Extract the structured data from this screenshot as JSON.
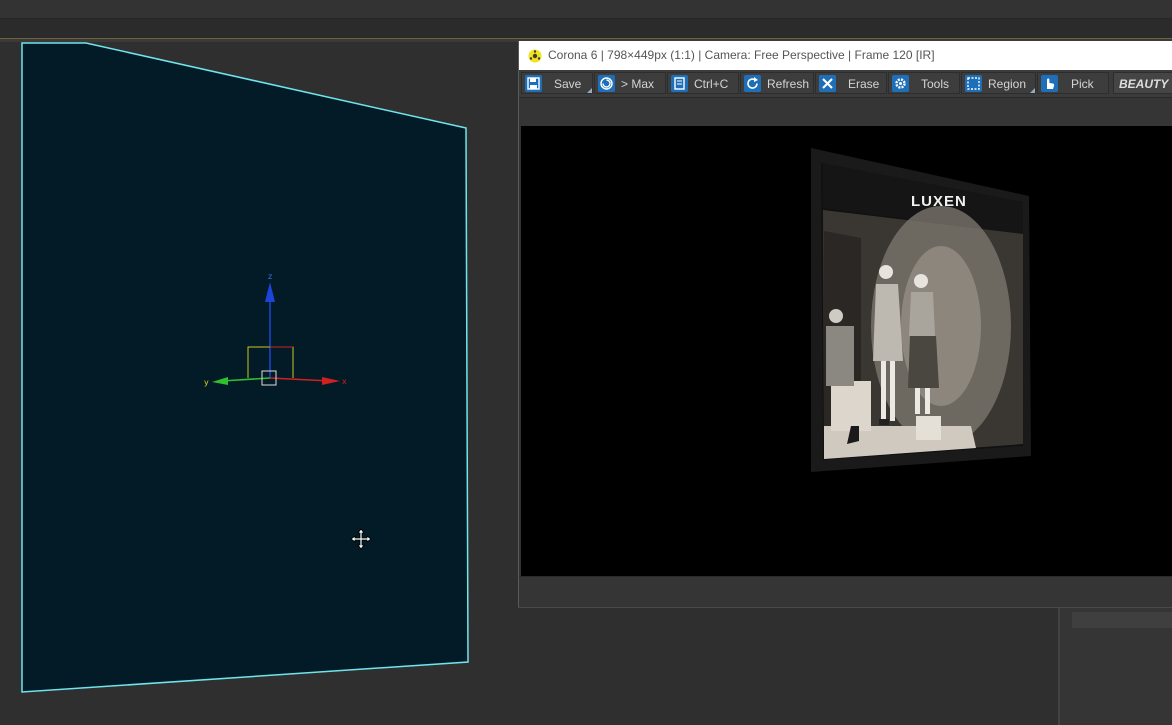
{
  "vfb": {
    "title": "Corona 6 | 798×449px (1:1) | Camera: Free Perspective | Frame 120 [IR]",
    "toolbar": [
      {
        "label": "Save",
        "icon": "save-icon"
      },
      {
        "label": "> Max",
        "icon": "spiral-icon"
      },
      {
        "label": "Ctrl+C",
        "icon": "copy-icon"
      },
      {
        "label": "Refresh",
        "icon": "refresh-icon"
      },
      {
        "label": "Erase",
        "icon": "close-icon"
      },
      {
        "label": "Tools",
        "icon": "gear-icon"
      },
      {
        "label": "Region",
        "icon": "region-icon"
      },
      {
        "label": "Pick",
        "icon": "hand-icon"
      }
    ],
    "channel": "BEAUTY",
    "render": {
      "sign_text": "LUXEN"
    }
  },
  "viewport": {
    "axis_labels": {
      "z": "z",
      "x": "x",
      "y": "y"
    },
    "colors": {
      "plane_fill": "#031b26",
      "plane_edge": "#6fe6ee",
      "x_axis": "#d22020",
      "y_axis": "#2fbf2f",
      "z_axis": "#1b44d8",
      "toolbar_icon": "#1f6fb8"
    }
  }
}
